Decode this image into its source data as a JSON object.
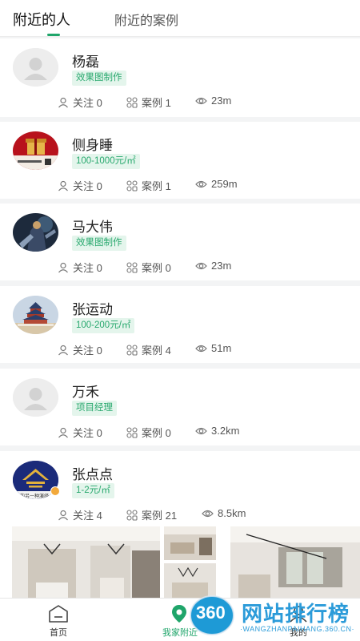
{
  "tabs": [
    {
      "label": "附近的人",
      "active": true
    },
    {
      "label": "附近的案例",
      "active": false
    }
  ],
  "accent": "#1fa56a",
  "people": [
    {
      "name": "杨磊",
      "tag": "效果图制作",
      "follow": "关注 0",
      "cases": "案例 1",
      "distance": "23m",
      "avatar": "default-avatar-icon"
    },
    {
      "name": "侧身睡",
      "tag": "100-1000元/㎡",
      "follow": "关注 0",
      "cases": "案例 1",
      "distance": "259m",
      "avatar": "red-gift-box-photo"
    },
    {
      "name": "马大伟",
      "tag": "效果图制作",
      "follow": "关注 0",
      "cases": "案例 0",
      "distance": "23m",
      "avatar": "character-artwork-photo"
    },
    {
      "name": "张运动",
      "tag": "100-200元/㎡",
      "follow": "关注 0",
      "cases": "案例 4",
      "distance": "51m",
      "avatar": "temple-photo"
    },
    {
      "name": "万禾",
      "tag": "项目经理",
      "follow": "关注 0",
      "cases": "案例 0",
      "distance": "3.2km",
      "avatar": "default-avatar-icon"
    },
    {
      "name": "张点点",
      "tag": "1-2元/㎡",
      "follow": "关注 4",
      "cases": "案例 21",
      "distance": "8.5km",
      "avatar": "gold-house-logo",
      "avatar_caption": "格的另一种演绎"
    }
  ],
  "nav": [
    {
      "label": "首页",
      "icon": "home-icon"
    },
    {
      "label": "我家附近",
      "icon": "location-pin-icon"
    },
    {
      "label": "我的",
      "icon": "user-icon"
    }
  ],
  "watermark": {
    "logo": "360",
    "title": "网站排行榜",
    "url": "WANGZHANPAIHANG.360.CN"
  }
}
